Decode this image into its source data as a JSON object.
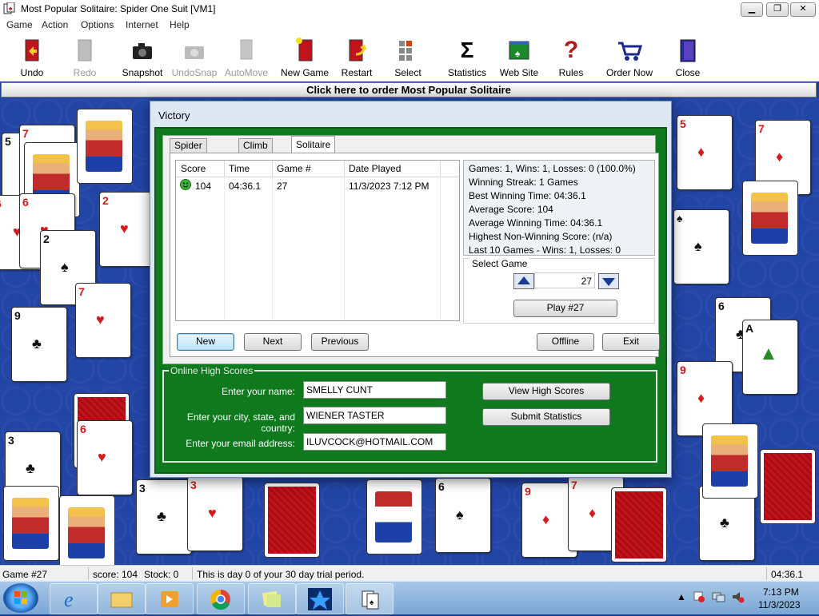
{
  "window": {
    "title": "Most Popular Solitaire: Spider One Suit [VM1]"
  },
  "menu": [
    "Game",
    "Action",
    "Options",
    "Internet",
    "Help"
  ],
  "toolbar": [
    {
      "label": "Undo",
      "enabled": true,
      "icon": "undo-icon"
    },
    {
      "label": "Redo",
      "enabled": false,
      "icon": "redo-icon"
    },
    {
      "label": "Snapshot",
      "enabled": true,
      "icon": "camera-icon"
    },
    {
      "label": "UndoSnap",
      "enabled": false,
      "icon": "undosnap-icon"
    },
    {
      "label": "AutoMove",
      "enabled": false,
      "icon": "automove-icon"
    },
    {
      "label": "New Game",
      "enabled": true,
      "icon": "new-game-icon"
    },
    {
      "label": "Restart",
      "enabled": true,
      "icon": "restart-icon"
    },
    {
      "label": "Select",
      "enabled": true,
      "icon": "select-icon"
    },
    {
      "label": "Statistics",
      "enabled": true,
      "icon": "sigma-icon"
    },
    {
      "label": "Web Site",
      "enabled": true,
      "icon": "website-icon"
    },
    {
      "label": "Rules",
      "enabled": true,
      "icon": "question-icon"
    },
    {
      "label": "Order Now",
      "enabled": true,
      "icon": "cart-icon"
    },
    {
      "label": "Close",
      "enabled": true,
      "icon": "close-door-icon"
    }
  ],
  "order_bar": "Click here to order Most Popular Solitaire",
  "dialog": {
    "title": "Victory",
    "tabs": [
      "Spider One Suit",
      "Climb Mode",
      "Solitaire"
    ],
    "active_tab": "Solitaire",
    "columns": [
      "Score",
      "Time",
      "Game #",
      "Date Played"
    ],
    "rows": [
      {
        "score": "104",
        "time": "04:36.1",
        "game": "27",
        "date": "11/3/2023 7:12 PM"
      }
    ],
    "stats": [
      "Games: 1, Wins: 1, Losses: 0  (100.0%)",
      "Winning Streak: 1 Games",
      "Best Winning Time: 04:36.1",
      "Average Score: 104",
      "Average Winning Time: 04:36.1",
      "Highest Non-Winning Score: (n/a)",
      "Last 10 Games - Wins: 1, Losses: 0"
    ],
    "select_game_label": "Select Game",
    "game_number": "27",
    "play_button": "Play #27",
    "buttons": {
      "new": "New",
      "next": "Next",
      "previous": "Previous",
      "offline": "Offline",
      "exit": "Exit"
    },
    "online": {
      "legend": "Online High Scores",
      "name_label": "Enter your name:",
      "name_value": "SMELLY CUNT",
      "city_label": "Enter your city, state, and country:",
      "city_value": "WIENER TASTER",
      "email_label": "Enter your email address:",
      "email_value": "ILUVCOCK@HOTMAIL.COM",
      "view_button": "View High Scores",
      "submit_button": "Submit Statistics"
    }
  },
  "status": {
    "game": "Game #27",
    "score": "score: 104",
    "stock": "Stock: 0",
    "trial": "This is day 0 of your 30 day trial period.",
    "time": "04:36.1"
  },
  "taskbar": {
    "time": "7:13 PM",
    "date": "11/3/2023"
  },
  "colors": {
    "felt": "#2245a6",
    "dialog_green": "#0f7a1d",
    "card_red": "#d41a1a"
  }
}
